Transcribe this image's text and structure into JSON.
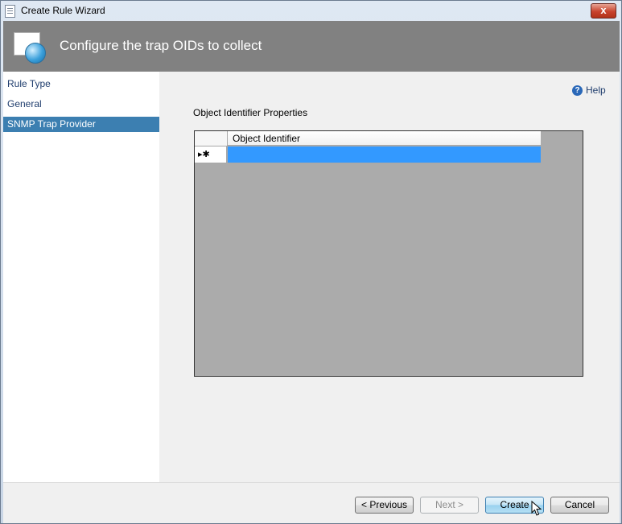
{
  "window": {
    "title": "Create Rule Wizard",
    "close_symbol": "x"
  },
  "header": {
    "title": "Configure the trap OIDs to collect"
  },
  "nav": {
    "items": [
      {
        "label": "Rule Type"
      },
      {
        "label": "General"
      },
      {
        "label": "SNMP Trap Provider"
      }
    ],
    "selected": "SNMP Trap Provider"
  },
  "help": {
    "label": "Help"
  },
  "main": {
    "section_label": "Object Identifier Properties",
    "grid": {
      "columns": [
        "Object Identifier"
      ],
      "rows": [
        {
          "row_marker": "▸✱",
          "object_identifier": ""
        }
      ]
    }
  },
  "buttons": {
    "previous": "< Previous",
    "next": "Next >",
    "create": "Create",
    "cancel": "Cancel"
  },
  "colors": {
    "selection": "#3c7fb1",
    "header_band": "#818181",
    "grid_background": "#ababab",
    "cell_selected": "#3399ff"
  }
}
